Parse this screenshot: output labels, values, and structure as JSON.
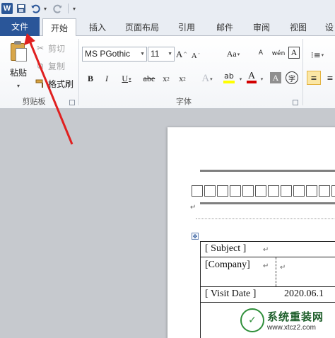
{
  "quick_access": {
    "app_logo": "W",
    "save_icon": "save-icon",
    "undo_icon": "undo-icon",
    "redo_icon": "redo-icon",
    "customize_icon": "customize-icon"
  },
  "tabs": {
    "file": "文件",
    "items": [
      "开始",
      "插入",
      "页面布局",
      "引用",
      "邮件",
      "审阅",
      "视图",
      "设"
    ],
    "active_index": 0
  },
  "clipboard": {
    "paste": "粘贴",
    "cut": "剪切",
    "copy": "复制",
    "format_painter": "格式刷",
    "group_label": "剪贴板"
  },
  "font": {
    "name": "MS PGothic",
    "size": "11",
    "grow": "A",
    "shrink": "A",
    "change_case": "Aa",
    "bold": "B",
    "italic": "I",
    "underline": "U",
    "strikethrough": "abe",
    "subscript": "x",
    "superscript": "x",
    "subscript_mark": "2",
    "superscript_mark": "2",
    "text_effect": "A",
    "highlight": "ab",
    "font_color": "A",
    "char_shading": "A",
    "enclose": "字",
    "phonetic": "wén",
    "char_border": "A",
    "group_label": "字体"
  },
  "colors": {
    "file_tab": "#2a5699",
    "highlight": "#ffff00",
    "font_color": "#d20000",
    "arrow": "#e02020"
  },
  "document": {
    "para_mark": "↵",
    "rows": [
      {
        "left": "[ Subject ]",
        "right": ""
      },
      {
        "left": "[Company]",
        "right": ""
      },
      {
        "left": "[ Visit Date ]",
        "right": "2020.06.1"
      }
    ]
  },
  "watermark": {
    "title": "系统重装网",
    "url": "www.xtcz2.com"
  }
}
